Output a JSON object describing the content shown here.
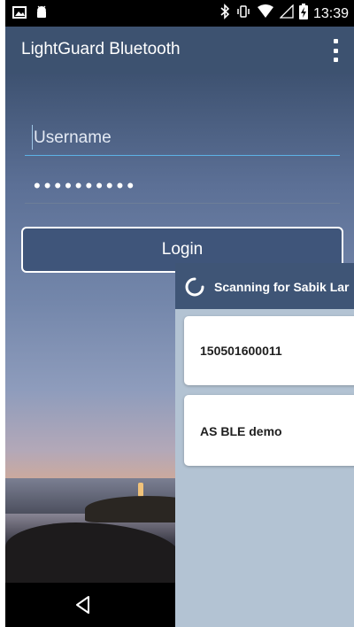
{
  "status_bar": {
    "time": "13:39",
    "icons": [
      "image-icon",
      "android-icon",
      "bluetooth-icon",
      "vibrate-icon",
      "wifi-icon",
      "signal-icon",
      "battery-charging-icon"
    ]
  },
  "app_bar": {
    "title": "LightGuard Bluetooth",
    "menu_icon": "overflow-menu-icon"
  },
  "login_form": {
    "username_placeholder": "Username",
    "username_value": "",
    "password_value": "••••••••••",
    "login_label": "Login"
  },
  "scan_dialog": {
    "title": "Scanning for Sabik Lar",
    "spinner_icon": "loading-spinner-icon",
    "devices": [
      {
        "name": "150501600011"
      },
      {
        "name": "AS BLE demo"
      }
    ]
  },
  "nav_bar": {
    "back_icon": "back-triangle-icon"
  },
  "colors": {
    "app_bar": "#3d5270",
    "dialog_bg": "#b3c3d3",
    "field_underline": "#5db2e6"
  }
}
